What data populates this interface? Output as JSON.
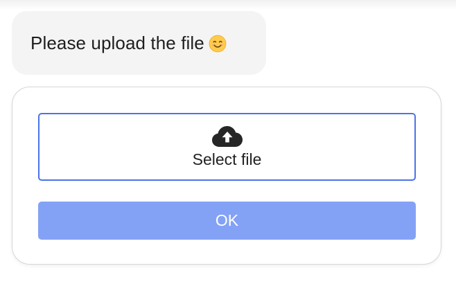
{
  "message": {
    "text": "Please upload the file",
    "emoji_icon": "smiling-face-emoji"
  },
  "upload": {
    "icon": "cloud-upload-icon",
    "select_label": "Select file",
    "ok_label": "OK"
  },
  "colors": {
    "bubble_bg": "#f4f4f4",
    "select_border": "#4a73e8",
    "ok_bg": "#84a2f5",
    "ok_text": "#ffffff"
  }
}
